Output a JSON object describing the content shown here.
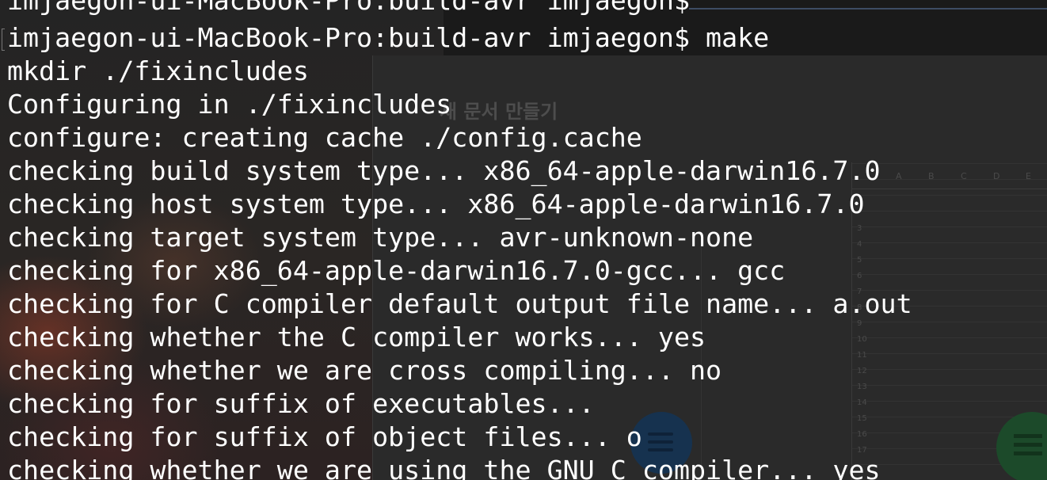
{
  "background": {
    "doc_title": "새 문서 만들기",
    "sheet_columns": [
      "A",
      "B",
      "C",
      "D",
      "E"
    ],
    "sheet_rows": [
      "3",
      "4",
      "5",
      "6",
      "7",
      "8",
      "9",
      "10",
      "11",
      "12",
      "13",
      "14",
      "15",
      "16",
      "17"
    ],
    "accent_blue": "#16324f",
    "accent_green": "#1c4a2a"
  },
  "terminal": {
    "text_color": "#ffffff",
    "lines": [
      "imjaegon-ui-MacBook-Pro:build-avr imjaegon$",
      "imjaegon-ui-MacBook-Pro:build-avr imjaegon$ make",
      "mkdir ./fixincludes",
      "Configuring in ./fixincludes",
      "configure: creating cache ./config.cache",
      "checking build system type... x86_64-apple-darwin16.7.0",
      "checking host system type... x86_64-apple-darwin16.7.0",
      "checking target system type... avr-unknown-none",
      "checking for x86_64-apple-darwin16.7.0-gcc... gcc",
      "checking for C compiler default output file name... a.out",
      "checking whether the C compiler works... yes",
      "checking whether we are cross compiling... no",
      "checking for suffix of executables...",
      "checking for suffix of object files... o",
      "checking whether we are using the GNU C compiler... yes"
    ]
  }
}
